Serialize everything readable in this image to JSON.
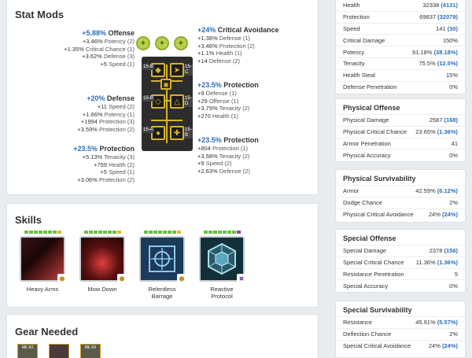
{
  "stat_mods": {
    "title": "Stat Mods",
    "blocks": [
      {
        "primary_value": "+5.88%",
        "primary_label": "Offense",
        "secondaries": [
          [
            "+3.46%",
            "Potency (2)"
          ],
          [
            "+1.35%",
            "Critical Chance (1)"
          ],
          [
            "+3.62%",
            "Defense (3)"
          ],
          [
            "+5",
            "Speed (1)"
          ]
        ]
      },
      {
        "primary_value": "+20%",
        "primary_label": "Defense",
        "secondaries": [
          [
            "+11",
            "Speed (2)"
          ],
          [
            "+1.66%",
            "Potency (1)"
          ],
          [
            "+1994",
            "Protection (3)"
          ],
          [
            "+3.59%",
            "Protection (2)"
          ]
        ]
      },
      {
        "primary_value": "+23.5%",
        "primary_label": "Protection",
        "secondaries": [
          [
            "+5.13%",
            "Tenacity (3)"
          ],
          [
            "+759",
            "Health (2)"
          ],
          [
            "+5",
            "Speed (1)"
          ],
          [
            "+3.06%",
            "Protection (2)"
          ]
        ]
      },
      {
        "primary_value": "+24%",
        "primary_label": "Critical Avoidance",
        "secondaries": [
          [
            "+1.38%",
            "Defense (1)"
          ],
          [
            "+3.46%",
            "Protection (2)"
          ],
          [
            "+1.1%",
            "Health (1)"
          ],
          [
            "+14",
            "Defense (2)"
          ]
        ]
      },
      {
        "primary_value": "+23.5%",
        "primary_label": "Protection",
        "secondaries": [
          [
            "+9",
            "Defense (1)"
          ],
          [
            "+29",
            "Offense (1)"
          ],
          [
            "+3.79%",
            "Tenacity (2)"
          ],
          [
            "+270",
            "Health (1)"
          ]
        ]
      },
      {
        "primary_value": "+23.5%",
        "primary_label": "Protection",
        "secondaries": [
          [
            "+804",
            "Protection (1)"
          ],
          [
            "+3.58%",
            "Tenacity (2)"
          ],
          [
            "+9",
            "Speed (2)"
          ],
          [
            "+2.63%",
            "Defense (2)"
          ]
        ]
      }
    ],
    "slot_labels": [
      "15-B",
      "15-C",
      "15-B",
      "15-D",
      "15-A",
      "15-B"
    ]
  },
  "skills": {
    "title": "Skills",
    "items": [
      {
        "name": "Heavy Arms",
        "pips": 8,
        "max": false
      },
      {
        "name": "Mow Down",
        "pips": 8,
        "max": false
      },
      {
        "name": "Relentless\nBarrage",
        "pips": 8,
        "max": false
      },
      {
        "name": "Reactive\nProtocol",
        "pips": 8,
        "max": true
      }
    ]
  },
  "gear": {
    "title": "Gear Needed",
    "items": [
      {
        "label": "Mk XII"
      },
      {
        "label": ""
      },
      {
        "label": "Mk XII"
      }
    ]
  },
  "stats": {
    "general_rows": [
      {
        "label": "Health",
        "value": "32338",
        "bonus": "(4131)"
      },
      {
        "label": "Protection",
        "value": "69837",
        "bonus": "(32079)"
      },
      {
        "label": "Speed",
        "value": "141",
        "bonus": "(30)"
      },
      {
        "label": "Critical Damage",
        "value": "150%",
        "bonus": ""
      },
      {
        "label": "Potency",
        "value": "91.18%",
        "bonus": "(38.18%)"
      },
      {
        "label": "Tenacity",
        "value": "75.5%",
        "bonus": "(12.5%)"
      },
      {
        "label": "Health Steal",
        "value": "15%",
        "bonus": ""
      },
      {
        "label": "Defense Penetration",
        "value": "0%",
        "bonus": ""
      }
    ],
    "physical_offense": {
      "title": "Physical Offense",
      "rows": [
        {
          "label": "Physical Damage",
          "value": "2587",
          "bonus": "(168)"
        },
        {
          "label": "Physical Critical Chance",
          "value": "23.65%",
          "bonus": "(1.36%)"
        },
        {
          "label": "Armor Penetration",
          "value": "41",
          "bonus": ""
        },
        {
          "label": "Physical Accuracy",
          "value": "0%",
          "bonus": ""
        }
      ]
    },
    "physical_survivability": {
      "title": "Physical Survivability",
      "rows": [
        {
          "label": "Armor",
          "value": "42.59%",
          "bonus": "(6.12%)"
        },
        {
          "label": "Dodge Chance",
          "value": "2%",
          "bonus": ""
        },
        {
          "label": "Physical Critical Avoidance",
          "value": "24%",
          "bonus": "(24%)"
        }
      ]
    },
    "special_offense": {
      "title": "Special Offense",
      "rows": [
        {
          "label": "Special Damage",
          "value": "2378",
          "bonus": "(156)"
        },
        {
          "label": "Special Critical Chance",
          "value": "11.36%",
          "bonus": "(1.36%)"
        },
        {
          "label": "Resistance Penetration",
          "value": "5",
          "bonus": ""
        },
        {
          "label": "Special Accuracy",
          "value": "0%",
          "bonus": ""
        }
      ]
    },
    "special_survivability": {
      "title": "Special Survivability",
      "rows": [
        {
          "label": "Resistance",
          "value": "45.91%",
          "bonus": "(5.57%)"
        },
        {
          "label": "Deflection Chance",
          "value": "2%",
          "bonus": ""
        },
        {
          "label": "Special Critical Avoidance",
          "value": "24%",
          "bonus": "(24%)"
        }
      ]
    }
  }
}
